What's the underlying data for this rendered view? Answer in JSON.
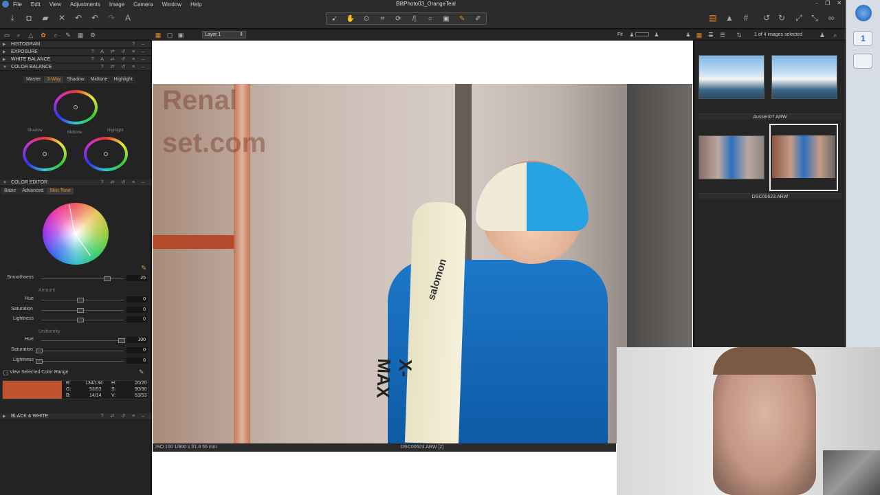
{
  "menubar": {
    "items": [
      "File",
      "Edit",
      "View",
      "Adjustments",
      "Image",
      "Camera",
      "Window",
      "Help"
    ],
    "window_title": "BlitPhoto03_OrangeTeal",
    "win_minimize": "–",
    "win_maximize": "❐",
    "win_close": "✕"
  },
  "secbar": {
    "layer": "Layer 1",
    "fit": "Fit",
    "images_selected": "1 of 4 images selected"
  },
  "left_panel": {
    "histogram": "HISTOGRAM",
    "exposure": "EXPOSURE",
    "white_balance": "WHITE BALANCE",
    "color_balance": "COLOR BALANCE",
    "color_balance_tabs": [
      "Master",
      "3-Way",
      "Shadow",
      "Midtone",
      "Highlight"
    ],
    "wheel_labels": {
      "shadow": "Shadow",
      "midtone": "Midtone",
      "highlight": "Highlight"
    },
    "color_editor": "COLOR EDITOR",
    "color_editor_tabs": [
      "Basic",
      "Advanced",
      "Skin Tone"
    ],
    "smoothness": {
      "label": "Smoothness",
      "value": "25"
    },
    "amount_label": "Amount",
    "amount": [
      {
        "label": "Hue",
        "value": "0"
      },
      {
        "label": "Saturation",
        "value": "0"
      },
      {
        "label": "Lightness",
        "value": "0"
      }
    ],
    "uniformity_label": "Uniformity",
    "uniformity": [
      {
        "label": "Hue",
        "value": "100"
      },
      {
        "label": "Saturation",
        "value": "0"
      },
      {
        "label": "Lightness",
        "value": "0"
      }
    ],
    "view_selected": "View Selected Color Range",
    "readout": {
      "r_label": "R:",
      "r": "134/134",
      "g_label": "G:",
      "g": "53/53",
      "b_label": "B:",
      "b": "14/14",
      "h_label": "H:",
      "h": "20/20",
      "s_label": "S:",
      "s": "90/90",
      "v_label": "V:",
      "v": "53/53"
    },
    "swatch_color": "#c0532f",
    "black_white": "BLACK & WHITE"
  },
  "viewer": {
    "info_left": "ISO 100  1/800 s  f/1.8  55 mm",
    "info_center": "DSC00623.ARW [2]",
    "photo_text_1": "Renal",
    "photo_text_2": "set.com",
    "ski_brand_1": "salomon",
    "ski_brand_2": "X-MAX"
  },
  "browser": {
    "label_1": "Aussen07.ARW",
    "label_2": "DSC00623.ARW"
  },
  "colors": {
    "accent": "#e58a2b"
  }
}
